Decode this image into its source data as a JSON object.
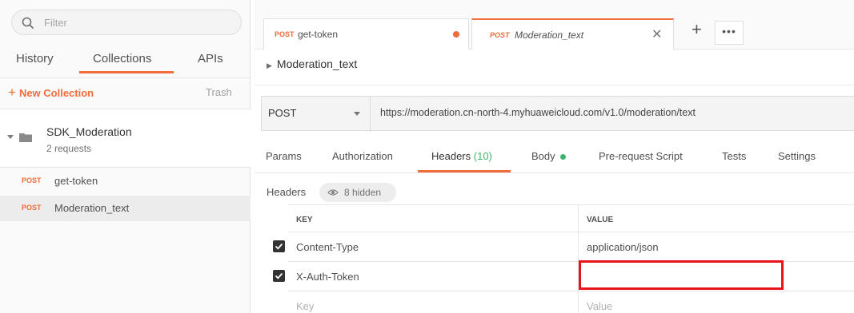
{
  "sidebar": {
    "filter_placeholder": "Filter",
    "tabs": [
      "History",
      "Collections",
      "APIs"
    ],
    "active_tab": "Collections",
    "new_collection": "New Collection",
    "trash": "Trash",
    "collection": {
      "name": "SDK_Moderation",
      "count": "2 requests"
    },
    "requests": [
      {
        "method": "POST",
        "name": "get-token"
      },
      {
        "method": "POST",
        "name": "Moderation_text"
      }
    ]
  },
  "tabs": [
    {
      "method": "POST",
      "name": "get-token",
      "unsaved": true
    },
    {
      "method": "POST",
      "name": "Moderation_text",
      "active": true
    }
  ],
  "request": {
    "title": "Moderation_text",
    "method": "POST",
    "url": "https://moderation.cn-north-4.myhuaweicloud.com/v1.0/moderation/text"
  },
  "subtabs": {
    "params": "Params",
    "authorization": "Authorization",
    "headers": "Headers",
    "headers_count": "(10)",
    "body": "Body",
    "prerequest": "Pre-request Script",
    "tests": "Tests",
    "settings": "Settings"
  },
  "headers_section": {
    "label": "Headers",
    "hidden": "8 hidden",
    "col_key": "KEY",
    "col_value": "VALUE",
    "rows": [
      {
        "key": "Content-Type",
        "value": "application/json",
        "checked": true
      },
      {
        "key": "X-Auth-Token",
        "value": "",
        "checked": true
      }
    ],
    "placeholder_key": "Key",
    "placeholder_value": "Value"
  },
  "colors": {
    "accent": "#f26b3a",
    "highlight": "#e8141b",
    "green": "#3db46d"
  }
}
